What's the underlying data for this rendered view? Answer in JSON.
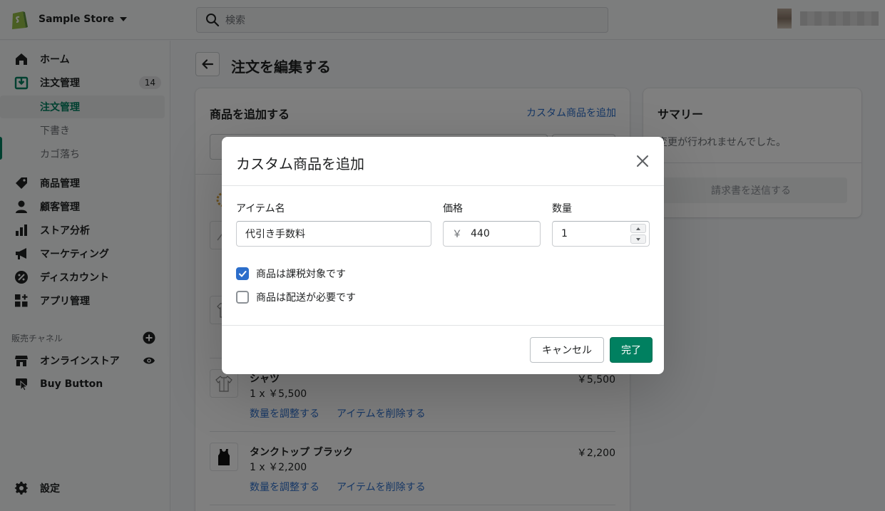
{
  "topbar": {
    "store_name": "Sample Store",
    "search_placeholder": "検索"
  },
  "sidebar": {
    "items": [
      {
        "label": "ホーム",
        "icon": "home-icon"
      },
      {
        "label": "注文管理",
        "icon": "orders-icon",
        "badge": "14"
      },
      {
        "label": "商品管理",
        "icon": "tag-icon"
      },
      {
        "label": "顧客管理",
        "icon": "person-icon"
      },
      {
        "label": "ストア分析",
        "icon": "bar-chart-icon"
      },
      {
        "label": "マーケティング",
        "icon": "megaphone-icon"
      },
      {
        "label": "ディスカウント",
        "icon": "discount-icon"
      },
      {
        "label": "アプリ管理",
        "icon": "apps-icon"
      }
    ],
    "sub_items": [
      "注文管理",
      "下書き",
      "カゴ落ち"
    ],
    "channels_title": "販売チャネル",
    "channels": [
      {
        "label": "オンラインストア",
        "icon": "store-icon"
      },
      {
        "label": "Buy Button",
        "icon": "buy-button-icon"
      }
    ],
    "settings_label": "設定"
  },
  "main": {
    "page_title": "注文を編集する",
    "add_products": {
      "title": "商品を追加する",
      "custom_link": "カスタム商品を追加"
    },
    "products": [
      {
        "name": "シャツ",
        "qty": "1 x ￥5,500",
        "price": "￥5,500",
        "adjust": "数量を調整する",
        "remove": "アイテムを削除する"
      },
      {
        "name": "タンクトップ ブラック",
        "qty": "1 x ￥2,200",
        "price": "￥2,200",
        "adjust": "数量を調整する",
        "remove": "アイテムを削除する"
      }
    ],
    "summary": {
      "title": "サマリー",
      "text": "変更が行われませんでした。",
      "send_invoice": "請求書を送信する"
    }
  },
  "modal": {
    "title": "カスタム商品を追加",
    "item_name_label": "アイテム名",
    "item_name_value": "代引き手数料",
    "price_label": "価格",
    "price_prefix": "￥",
    "price_value": "440",
    "qty_label": "数量",
    "qty_value": "1",
    "taxable_label": "商品は課税対象です",
    "taxable_checked": true,
    "shipping_label": "商品は配送が必要です",
    "shipping_checked": false,
    "cancel": "キャンセル",
    "done": "完了"
  },
  "colors": {
    "primary": "#008060",
    "link": "#2c6ecb",
    "checkbox_checked": "#2c6ecb"
  }
}
